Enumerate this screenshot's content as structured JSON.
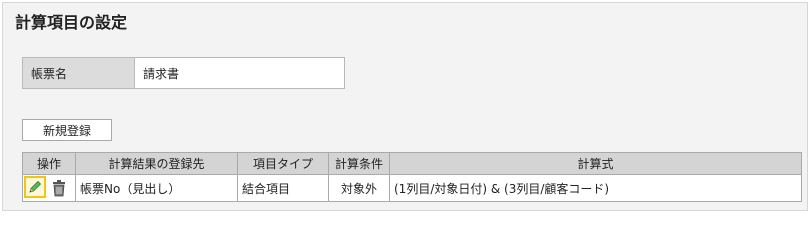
{
  "page": {
    "title": "計算項目の設定"
  },
  "form": {
    "label": "帳票名",
    "value": "請求書"
  },
  "toolbar": {
    "new_button": "新規登録"
  },
  "table": {
    "headers": {
      "op": "操作",
      "dest": "計算結果の登録先",
      "type": "項目タイプ",
      "cond": "計算条件",
      "expr": "計算式"
    },
    "rows": [
      {
        "dest": "帳票No（見出し）",
        "type": "結合項目",
        "cond": "対象外",
        "expr": "(1列目/対象日付) & (3列目/顧客コード)"
      }
    ]
  },
  "icons": {
    "edit": "pencil-icon",
    "delete": "trash-icon"
  },
  "colors": {
    "highlight": "#f0c419",
    "pencil": "#4caf50",
    "header_bg": "#d4d4d4"
  }
}
